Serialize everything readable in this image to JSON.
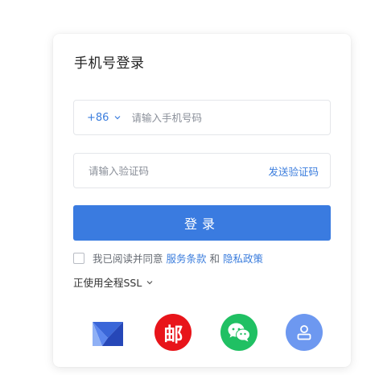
{
  "login": {
    "title": "手机号登录",
    "country_code": "+86",
    "phone_placeholder": "请输入手机号码",
    "code_placeholder": "请输入验证码",
    "send_code_label": "发送验证码",
    "submit_label": "登录",
    "agree_prefix": "我已阅读并同意",
    "terms_label": "服务条款",
    "and_text": "和",
    "privacy_label": "隐私政策",
    "ssl_label": "正使用全程SSL"
  },
  "third_party": {
    "post_glyph": "邮",
    "icons": [
      "mail-icon",
      "post-office-icon",
      "wechat-icon",
      "account-icon"
    ]
  },
  "colors": {
    "accent": "#3a7be0",
    "link": "#3b7ddd",
    "post_red": "#e8141a",
    "wechat_green": "#20c063",
    "account_blue": "#6d98f0"
  }
}
